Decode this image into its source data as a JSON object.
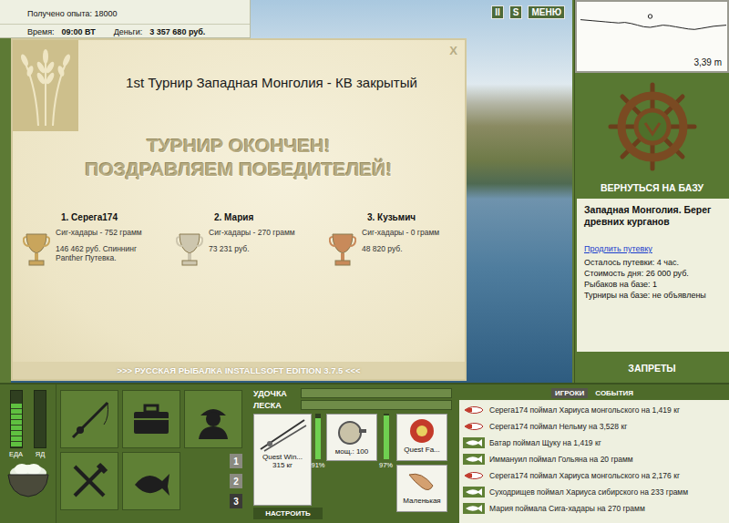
{
  "status": {
    "experience": "Получено опыта: 18000",
    "time_label": "Время:",
    "time": "09:00 ВТ",
    "money_label": "Деньги:",
    "money": "3 357 680 руб."
  },
  "top_buttons": [
    "II",
    "S",
    "МЕНЮ"
  ],
  "depth": {
    "reading": "3,39 m",
    "profile": [
      1.6,
      1.7,
      1.8,
      1.9,
      2.0,
      2.1,
      2.2,
      2.1,
      2.3,
      2.6,
      2.9,
      3.0,
      2.8,
      2.6,
      2.7,
      2.9,
      3.1,
      3.3,
      3.39,
      3.2,
      3.0,
      2.8,
      2.7,
      2.6
    ],
    "marker_index": 11
  },
  "tournament": {
    "title": "1st Турнир Западная Монголия - КВ закрытый",
    "close": "X",
    "headline": [
      "ТУРНИР ОКОНЧЕН!",
      "ПОЗДРАВЛЯЕМ ПОБЕДИТЕЛЕЙ!"
    ],
    "winners": [
      {
        "place": "1. Серега174",
        "fish": "Сиг-хадары - 752 грамм",
        "prize": "146 462 руб. Спиннинг Panther Путевка.",
        "cup_color": "#c9a55c"
      },
      {
        "place": "2. Мария",
        "fish": "Сиг-хадары - 270 грамм",
        "prize": "73 231 руб.",
        "cup_color": "#cdc6ae"
      },
      {
        "place": "3. Кузьмич",
        "fish": "Сиг-хадары - 0 грамм",
        "prize": "48 820 руб.",
        "cup_color": "#c88a5a"
      }
    ],
    "footer": ">>> РУССКАЯ РЫБАЛКА INSTALLSOFT EDITION 3.7.5 <<<"
  },
  "base": {
    "return_label": "ВЕРНУТЬСЯ НА БАЗУ",
    "location": "Западная Монголия. Берег древних курганов",
    "extend_link": "Продлить путевку",
    "info": [
      "Осталось путевки: 4 час.",
      "Стоимость дня: 26 000 руб.",
      "Рыбаков на базе: 1",
      "Турниры на базе: не объявлены"
    ],
    "bans_label": "ЗАПРЕТЫ"
  },
  "needs": [
    {
      "label": "ЕДА",
      "level": 0.78
    },
    {
      "label": "ЯД",
      "level": 0.0
    }
  ],
  "slots": [
    {
      "label": "1",
      "selected": false
    },
    {
      "label": "2",
      "selected": false
    },
    {
      "label": "3",
      "selected": true
    }
  ],
  "tension": [
    {
      "label": "УДОЧКА",
      "level": 0.0
    },
    {
      "label": "ЛЕСКА",
      "level": 0.0
    }
  ],
  "tackle": {
    "rod": {
      "name": "Quest Win...",
      "weight": "315 кг",
      "level": 0.91,
      "reading": "91%"
    },
    "reel": {
      "name": "мощ.: 100",
      "level": 0.97,
      "reading": "97%"
    },
    "line": {
      "name": "Quest Fa..."
    },
    "lure": {
      "name": "Маленькая"
    },
    "configure": "НАСТРОИТЬ"
  },
  "log": {
    "tabs": [
      {
        "label": "ИГРОКИ",
        "selected": true
      },
      {
        "label": "СОБЫТИЯ",
        "selected": false
      }
    ],
    "entries": [
      {
        "text": "Серега174 поймал Хариуса монгольского на 1,419 кг",
        "kind": "lure"
      },
      {
        "text": "Серега174 поймал Нельму на 3,528 кг",
        "kind": "lure"
      },
      {
        "text": "Батар поймал Щуку на 1,419 кг",
        "kind": "fish"
      },
      {
        "text": "Иммануил поймал Гольяна на 20 грамм",
        "kind": "fish"
      },
      {
        "text": "Серега174 поймал Хариуса монгольского на 2,176 кг",
        "kind": "lure"
      },
      {
        "text": "Суходрищев поймал Хариуса сибирского на 233 грамм",
        "kind": "fish"
      },
      {
        "text": "Мария поймала Сига-хадары на 270 грамм",
        "kind": "fish"
      }
    ]
  }
}
